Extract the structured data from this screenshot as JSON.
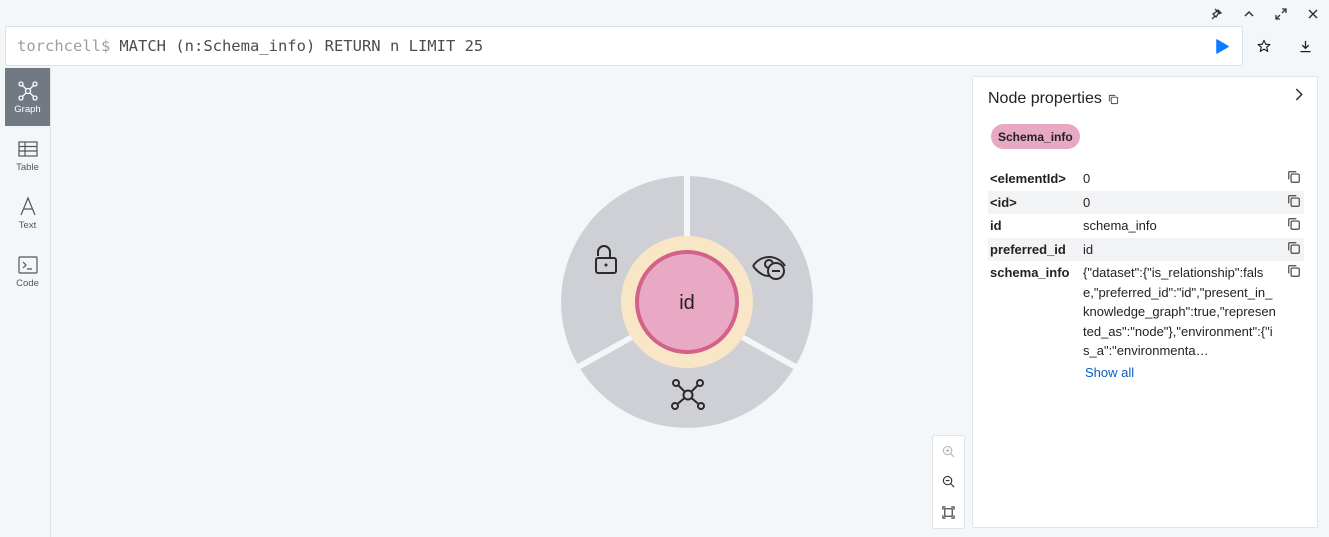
{
  "query": {
    "prompt": "torchcell$",
    "text": "MATCH (n:Schema_info) RETURN n LIMIT 25"
  },
  "window_controls": [
    "pin-icon",
    "chevron-up-icon",
    "expand-icon",
    "close-icon"
  ],
  "query_actions": [
    "run-icon",
    "star-icon",
    "download-icon"
  ],
  "nav": {
    "items": [
      {
        "label": "Graph",
        "icon": "graph-icon",
        "active": true
      },
      {
        "label": "Table",
        "icon": "table-icon",
        "active": false
      },
      {
        "label": "Text",
        "icon": "text-icon",
        "active": false
      },
      {
        "label": "Code",
        "icon": "code-icon",
        "active": false
      }
    ]
  },
  "graph": {
    "node_caption": "id",
    "node_color": "#e9a9c4",
    "node_border": "#d2628a",
    "ring_color": "#f8e6c6",
    "menu_color": "#ced0d6",
    "menu_actions": [
      "unlock-icon",
      "hide-icon",
      "expand-graph-icon"
    ]
  },
  "zoom_controls": [
    "zoom-in-icon",
    "zoom-out-icon",
    "fit-icon"
  ],
  "panel": {
    "title": "Node properties",
    "label": "Schema_info",
    "label_color": "#e7a8c3",
    "properties": [
      {
        "key": "<elementId>",
        "value": "0"
      },
      {
        "key": "<id>",
        "value": "0"
      },
      {
        "key": "id",
        "value": "schema_info"
      },
      {
        "key": "preferred_id",
        "value": "id"
      },
      {
        "key": "schema_info",
        "value": "{\"dataset\":{\"is_relationship\":false,\"preferred_id\":\"id\",\"present_in_knowledge_graph\":true,\"represented_as\":\"node\"},\"environment\":{\"is_a\":\"environmenta…"
      }
    ],
    "show_all": "Show all"
  },
  "colors": {
    "accent": "#0a7cff",
    "nav_active": "#717a83",
    "link": "#0a5fc0"
  }
}
